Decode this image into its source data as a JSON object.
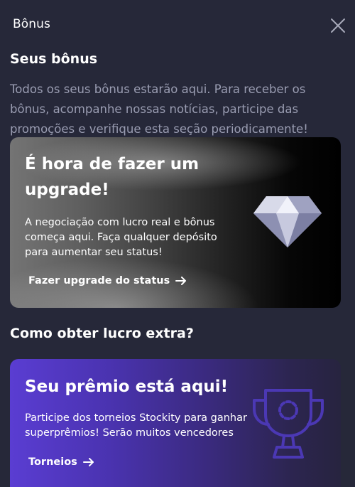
{
  "header": {
    "title": "Bônus"
  },
  "my_bonuses": {
    "title": "Seus bônus",
    "description": "Todos os seus bônus estarão aqui. Para receber os bônus, acompanhe nossas notícias, participe das promoções e verifique esta seção periodicamente!"
  },
  "upgrade_card": {
    "heading": "É hora de fazer um upgrade!",
    "body": "A negociação com lucro real e bônus começa aqui. Faça qualquer depósito para aumentar seu status!",
    "link_label": "Fazer upgrade do status",
    "icon": "diamond-icon"
  },
  "extra_profit": {
    "title": "Como obter lucro extra?"
  },
  "prize_card": {
    "heading": "Seu prêmio está aqui!",
    "body": "Participe dos torneios Stockity para ganhar superprêmios! Serão muitos vencedores",
    "link_label": "Torneios",
    "icon": "trophy-icon"
  },
  "colors": {
    "background": "#262839",
    "muted_text": "#9a9db2",
    "prize_accent": "#5a3dd2"
  }
}
